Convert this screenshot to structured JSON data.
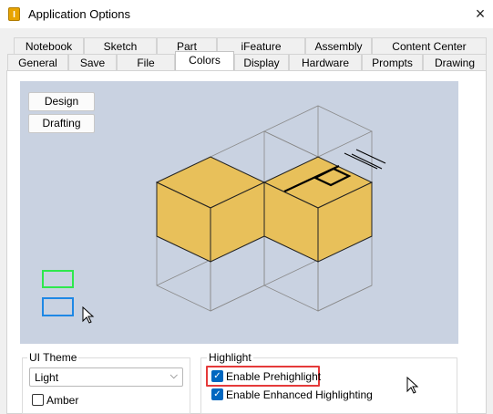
{
  "window": {
    "title": "Application Options",
    "app_icon": "I",
    "close_icon": "×"
  },
  "tabs_row1": [
    "Notebook",
    "Sketch",
    "Part",
    "iFeature",
    "Assembly",
    "Content Center"
  ],
  "tabs_row2": [
    "General",
    "Save",
    "File",
    "Colors",
    "Display",
    "Hardware",
    "Prompts",
    "Drawing"
  ],
  "active_tab": "Colors",
  "preview": {
    "design_label": "Design",
    "drafting_label": "Drafting",
    "prehighlight_swatch_color": "#2ee84d",
    "highlight_swatch_color": "#1e88e5",
    "background_color": "#c9d2e1",
    "part_color": "#e8c05a"
  },
  "ui_theme": {
    "label": "UI Theme",
    "selected": "Light",
    "amber_label": "Amber",
    "amber_checked": false
  },
  "highlight": {
    "label": "Highlight",
    "prehighlight_label": "Enable Prehighlight",
    "prehighlight_checked": true,
    "enhanced_label": "Enable Enhanced Highlighting",
    "enhanced_checked": true
  }
}
